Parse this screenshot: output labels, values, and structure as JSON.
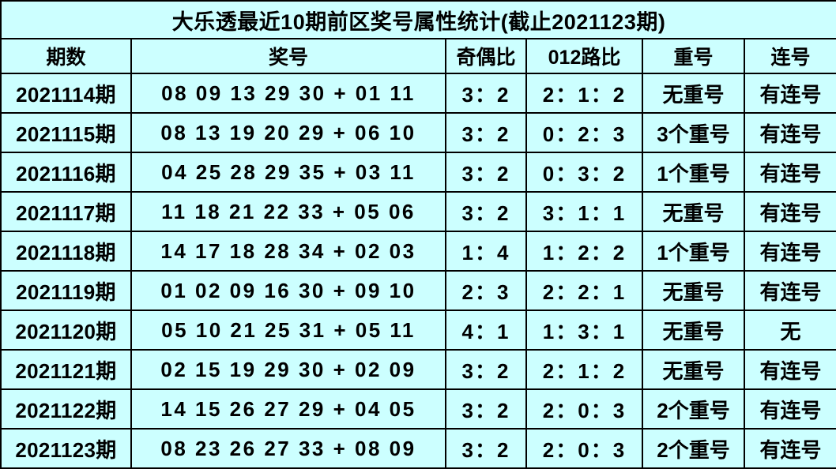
{
  "table": {
    "title": "大乐透最近10期前区奖号属性统计(截止2021123期)",
    "columns": [
      {
        "key": "issue",
        "label": "期数"
      },
      {
        "key": "numbers",
        "label": "奖号"
      },
      {
        "key": "odd_even",
        "label": "奇偶比"
      },
      {
        "key": "road012",
        "label": "012路比"
      },
      {
        "key": "repeat",
        "label": "重号"
      },
      {
        "key": "consecutive",
        "label": "连号"
      }
    ],
    "colors": {
      "cell_bg": "#CCFFFF",
      "gray_bg": "#BFBFBF",
      "cream_bg": "#FFFFCC",
      "yellow_bg": "#FFFF00",
      "cyan_bg": "#00FFFF",
      "border": "#000000",
      "text": "#000000"
    },
    "rows": [
      {
        "issue": "2021114期",
        "numbers": "08  09  13  29  30  +  01  11",
        "odd_even": "3：2",
        "road012": "2：1：2",
        "repeat": "无重号",
        "repeat_bg": "bg-gray",
        "consecutive": "有连号",
        "consecutive_bg": "bg-yellow"
      },
      {
        "issue": "2021115期",
        "numbers": "08  13  19  20  29  +  06  10",
        "odd_even": "3：2",
        "road012": "0：2：3",
        "repeat": "3个重号",
        "repeat_bg": "bg-cream",
        "consecutive": "有连号",
        "consecutive_bg": "bg-yellow"
      },
      {
        "issue": "2021116期",
        "numbers": "04  25  28  29  35  +  03  11",
        "odd_even": "3：2",
        "road012": "0：3：2",
        "repeat": "1个重号",
        "repeat_bg": "bg-cream",
        "consecutive": "有连号",
        "consecutive_bg": "bg-yellow"
      },
      {
        "issue": "2021117期",
        "numbers": "11  18  21  22  33  +  05  06",
        "odd_even": "3：2",
        "road012": "3：1：1",
        "repeat": "无重号",
        "repeat_bg": "bg-gray",
        "consecutive": "有连号",
        "consecutive_bg": "bg-yellow"
      },
      {
        "issue": "2021118期",
        "numbers": "14  17  18  28  34  +  02  03",
        "odd_even": "1：4",
        "road012": "1：2：2",
        "repeat": "1个重号",
        "repeat_bg": "bg-cream",
        "consecutive": "有连号",
        "consecutive_bg": "bg-yellow"
      },
      {
        "issue": "2021119期",
        "numbers": "01  02  09  16  30  +  09  10",
        "odd_even": "2：3",
        "road012": "2：2：1",
        "repeat": "无重号",
        "repeat_bg": "bg-gray",
        "consecutive": "有连号",
        "consecutive_bg": "bg-yellow"
      },
      {
        "issue": "2021120期",
        "numbers": "05  10  21  25  31  +  05  11",
        "odd_even": "4：1",
        "road012": "1：3：1",
        "repeat": "无重号",
        "repeat_bg": "bg-gray",
        "consecutive": "无",
        "consecutive_bg": "bg-cyan"
      },
      {
        "issue": "2021121期",
        "numbers": "02  15  19  29  30  +  02  09",
        "odd_even": "3：2",
        "road012": "2：1：2",
        "repeat": "无重号",
        "repeat_bg": "bg-gray",
        "consecutive": "有连号",
        "consecutive_bg": "bg-yellow"
      },
      {
        "issue": "2021122期",
        "numbers": "14  15  26  27  29  +  04  05",
        "odd_even": "3：2",
        "road012": "2：0：3",
        "repeat": "2个重号",
        "repeat_bg": "bg-cream",
        "consecutive": "有连号",
        "consecutive_bg": "bg-yellow"
      },
      {
        "issue": "2021123期",
        "numbers": "08  23  26  27  33  +  08  09",
        "odd_even": "3：2",
        "road012": "2：0：3",
        "repeat": "2个重号",
        "repeat_bg": "bg-cream",
        "consecutive": "有连号",
        "consecutive_bg": "bg-yellow"
      }
    ]
  }
}
